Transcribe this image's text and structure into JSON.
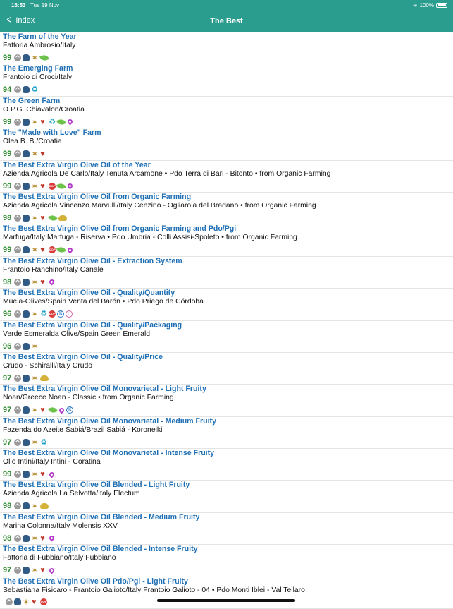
{
  "status": {
    "time": "16:53",
    "date": "Tue 19 Nov",
    "battery": "100%"
  },
  "nav": {
    "back_label": "Index",
    "title": "The Best"
  },
  "items": [
    {
      "title": "The Farm of the Year",
      "subtitle": "Fattoria Ambrosio/Italy",
      "score": "99",
      "icons": [
        "extraction-icon",
        "bottle-icon",
        "star-icon",
        "leaf-icon"
      ]
    },
    {
      "title": "The Emerging Farm",
      "subtitle": "Frantoio di Croci/Italy",
      "score": "94",
      "icons": [
        "extraction-icon",
        "bottle-icon",
        "recycle-icon"
      ]
    },
    {
      "title": "The Green Farm",
      "subtitle": "O.P.G. Chiavalon/Croatia",
      "score": "99",
      "icons": [
        "extraction-icon",
        "bottle-icon",
        "star-icon",
        "heart-icon",
        "recycle-icon",
        "leaf-icon",
        "pin-icon"
      ]
    },
    {
      "title": "The \"Made with Love\" Farm",
      "subtitle": "Olea B. B./Croatia",
      "score": "99",
      "icons": [
        "extraction-icon",
        "bottle-icon",
        "star-icon",
        "heart-icon"
      ]
    },
    {
      "title": "The Best Extra Virgin Olive Oil of the Year",
      "subtitle": "Azienda Agricola De Carlo/Italy Tenuta Arcamone • Pdo Terra di Bari - Bitonto • from Organic Farming",
      "score": "99",
      "icons": [
        "extraction-icon",
        "bottle-icon",
        "star-icon",
        "heart-icon",
        "dop-icon",
        "leaf-icon",
        "pin-icon"
      ]
    },
    {
      "title": "The Best Extra Virgin Olive Oil from Organic Farming",
      "subtitle": "Azienda Agricola Vincenzo Marvulli/Italy Cenzino - Ogliarola del Bradano • from Organic Farming",
      "score": "98",
      "icons": [
        "extraction-icon",
        "bottle-icon",
        "star-icon",
        "heart-icon",
        "leaf-icon",
        "chick-icon"
      ]
    },
    {
      "title": "The Best Extra Virgin Olive Oil from Organic Farming and Pdo/Pgi",
      "subtitle": "Marfuga/Italy Marfuga - Riserva • Pdo Umbria - Colli Assisi-Spoleto • from Organic Farming",
      "score": "99",
      "icons": [
        "extraction-icon",
        "bottle-icon",
        "star-icon",
        "heart-icon",
        "dop-icon",
        "leaf-icon",
        "pin-icon"
      ]
    },
    {
      "title": "The Best Extra Virgin Olive Oil - Extraction System",
      "subtitle": "Frantoio Ranchino/Italy Canale",
      "score": "98",
      "icons": [
        "extraction-icon",
        "bottle-icon",
        "star-icon",
        "heart-icon",
        "pin-icon"
      ]
    },
    {
      "title": "The Best Extra Virgin Olive Oil - Quality/Quantity",
      "subtitle": "Muela-Olives/Spain Venta del Barón • Pdo Priego de Córdoba",
      "score": "96",
      "icons": [
        "extraction-icon",
        "bottle-icon",
        "star-icon",
        "recycle-icon",
        "dop-icon",
        "kosher-icon",
        "halal-icon"
      ]
    },
    {
      "title": "The Best Extra Virgin Olive Oil - Quality/Packaging",
      "subtitle": "Verde Esmeralda Olive/Spain Green Emerald",
      "score": "96",
      "icons": [
        "extraction-icon",
        "bottle-icon",
        "star-icon"
      ]
    },
    {
      "title": "The Best Extra Virgin Olive Oil - Quality/Price",
      "subtitle": "Crudo - Schiralli/Italy Crudo",
      "score": "97",
      "icons": [
        "extraction-icon",
        "bottle-icon",
        "star-icon",
        "chick-icon"
      ]
    },
    {
      "title": "The Best Extra Virgin Olive Oil Monovarietal - Light Fruity",
      "subtitle": "Noan/Greece Noan - Classic • from Organic Farming",
      "score": "97",
      "icons": [
        "extraction-icon",
        "bottle-icon",
        "star-icon",
        "heart-icon",
        "leaf-icon",
        "pin-icon",
        "kosher-icon"
      ]
    },
    {
      "title": "The Best Extra Virgin Olive Oil Monovarietal - Medium Fruity",
      "subtitle": "Fazenda do Azeite Sabiá/Brazil Sabiá - Koroneiki",
      "score": "97",
      "icons": [
        "extraction-icon",
        "bottle-icon",
        "star-icon",
        "recycle-icon"
      ]
    },
    {
      "title": "The Best Extra Virgin Olive Oil Monovarietal - Intense Fruity",
      "subtitle": "Olio Intini/Italy Intini - Coratina",
      "score": "99",
      "icons": [
        "extraction-icon",
        "bottle-icon",
        "star-icon",
        "heart-icon",
        "pin-icon"
      ]
    },
    {
      "title": "The Best Extra Virgin Olive Oil Blended - Light Fruity",
      "subtitle": "Azienda Agricola La Selvotta/Italy Electum",
      "score": "98",
      "icons": [
        "extraction-icon",
        "bottle-icon",
        "star-icon",
        "chick-icon"
      ]
    },
    {
      "title": "The Best Extra Virgin Olive Oil Blended - Medium Fruity",
      "subtitle": "Marina Colonna/Italy Molensis XXV",
      "score": "98",
      "icons": [
        "extraction-icon",
        "bottle-icon",
        "star-icon",
        "heart-icon",
        "pin-icon"
      ]
    },
    {
      "title": "The Best Extra Virgin Olive Oil Blended - Intense Fruity",
      "subtitle": "Fattoria di Fubbiano/Italy Fubbiano",
      "score": "97",
      "icons": [
        "extraction-icon",
        "bottle-icon",
        "star-icon",
        "heart-icon",
        "pin-icon"
      ]
    },
    {
      "title": "The Best Extra Virgin Olive Oil Pdo/Pgi - Light Fruity",
      "subtitle": "Sebastiana Fisicaro - Frantoio Galioto/Italy Frantoio Galioto - 04 • Pdo Monti Iblei - Val Tellaro",
      "score": "",
      "icons": [
        "extraction-icon",
        "bottle-icon",
        "star-icon",
        "heart-icon",
        "dop-icon"
      ]
    }
  ]
}
